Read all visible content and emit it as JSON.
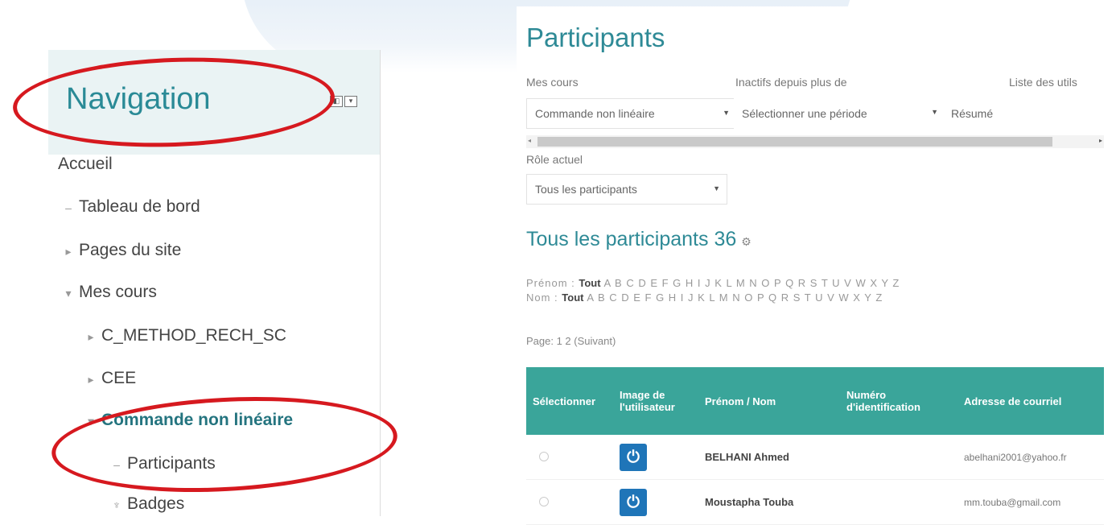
{
  "navigation": {
    "title": "Navigation",
    "items": [
      {
        "label": "Accueil",
        "glyph": ""
      },
      {
        "label": "Tableau de bord",
        "glyph": "–"
      },
      {
        "label": "Pages du site",
        "glyph": "▸"
      },
      {
        "label": "Mes cours",
        "glyph": "▾"
      },
      {
        "label": "C_METHOD_RECH_SC",
        "glyph": "▸"
      },
      {
        "label": "CEE",
        "glyph": "▸"
      },
      {
        "label": "Commande non linéaire",
        "glyph": "▾"
      },
      {
        "label": "Participants",
        "glyph": "–"
      },
      {
        "label": "Badges",
        "glyph": "♆"
      }
    ]
  },
  "participants": {
    "title": "Participants",
    "filters": {
      "mes_cours_label": "Mes cours",
      "mes_cours_value": "Commande non linéaire",
      "inactifs_label": "Inactifs depuis plus de",
      "inactifs_value": "Sélectionner une période",
      "liste_label": "Liste des utils",
      "liste_value": "Résumé",
      "role_label": "Rôle actuel",
      "role_value": "Tous les participants"
    },
    "heading": "Tous les participants 36",
    "prenom_label": "Prénom :",
    "nom_label": "Nom :",
    "tout": "Tout",
    "letters": "A B C D E F G H I J K L M N O P Q R S T U V W X Y Z",
    "pager": "Page: 1 2 (Suivant)",
    "table": {
      "headers": [
        "Sélectionner",
        "Image de l'utilisateur",
        "Prénom / Nom",
        "Numéro d'identification",
        "Adresse de courriel"
      ],
      "rows": [
        {
          "name": "BELHANI Ahmed",
          "id": "",
          "email": "abelhani2001@yahoo.fr"
        },
        {
          "name": "Moustapha Touba",
          "id": "",
          "email": "mm.touba@gmail.com"
        }
      ]
    }
  },
  "colors": {
    "accent": "#2e8a96",
    "table_header": "#3aa59a",
    "highlight": "#d6191f",
    "avatar": "#1f75b8"
  }
}
